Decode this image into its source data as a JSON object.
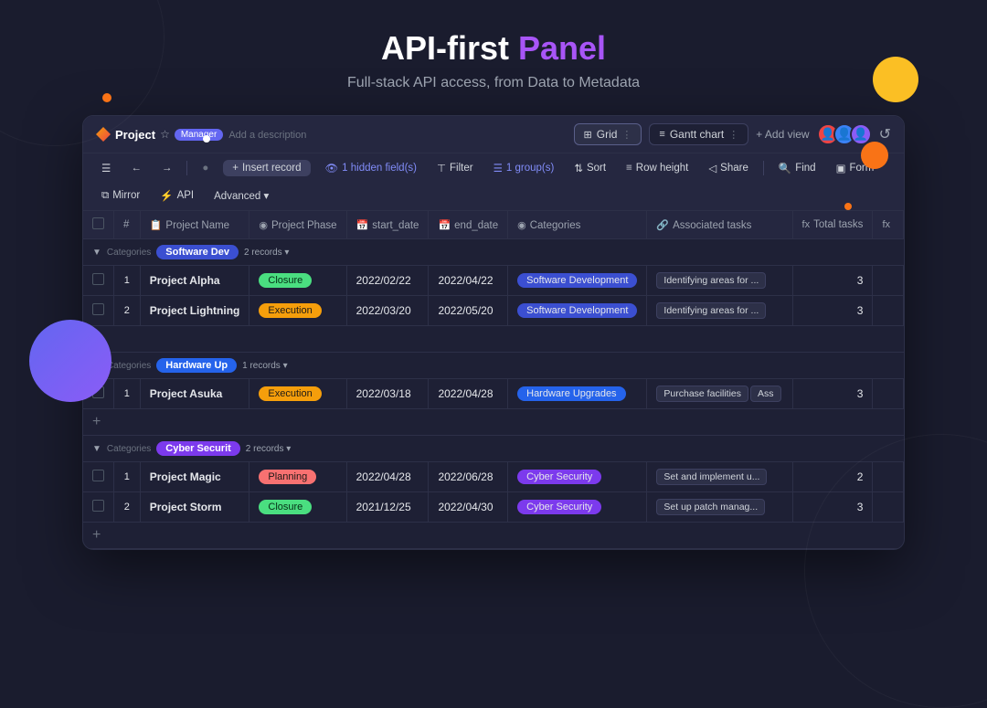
{
  "header": {
    "title_black": "API-first ",
    "title_purple": "Panel",
    "subtitle": "Full-stack API access, from Data to Metadata"
  },
  "panel": {
    "project_name": "Project",
    "manager_label": "Manager",
    "add_description": "Add a description",
    "tabs": [
      {
        "label": "Grid",
        "icon": "⊞",
        "active": true
      },
      {
        "label": "Gantt chart",
        "icon": "≡",
        "active": false
      }
    ],
    "add_view": "+ Add view",
    "avatars": [
      "🧑‍🦰",
      "👩",
      "👨"
    ],
    "refresh_icon": "↺"
  },
  "toolbar": {
    "back": "←",
    "forward": "→",
    "dot": "●",
    "insert": "Insert record",
    "hidden_fields": "1 hidden field(s)",
    "filter": "Filter",
    "group": "1 group(s)",
    "sort": "Sort",
    "row_height": "Row height",
    "share": "Share",
    "find": "Find",
    "form": "Form",
    "mirror": "Mirror",
    "api": "API",
    "advanced": "Advanced ▾"
  },
  "columns": [
    {
      "label": "Project Name",
      "icon": "📋"
    },
    {
      "label": "Project Phase",
      "icon": "◉"
    },
    {
      "label": "start_date",
      "icon": "📅"
    },
    {
      "label": "end_date",
      "icon": "📅"
    },
    {
      "label": "Categories",
      "icon": "◉"
    },
    {
      "label": "Associated tasks",
      "icon": "🔗"
    },
    {
      "label": "Total tasks",
      "icon": "fx"
    }
  ],
  "groups": [
    {
      "name": "Software Dev",
      "label": "Categories",
      "records_count": "2 records",
      "tag_class": "software",
      "rows": [
        {
          "num": 1,
          "project": "Project Alpha",
          "phase": "Closure",
          "phase_class": "phase-closure",
          "start_date": "2022/02/22",
          "end_date": "2022/04/22",
          "category": "Software Development",
          "cat_class": "cat-sw",
          "tasks": [
            "Identifying areas for ..."
          ],
          "total": 3
        },
        {
          "num": 2,
          "project": "Project Lightning",
          "phase": "Execution",
          "phase_class": "phase-execution",
          "start_date": "2022/03/20",
          "end_date": "2022/05/20",
          "category": "Software Development",
          "cat_class": "cat-sw",
          "tasks": [
            "Identifying areas for ..."
          ],
          "total": 3
        }
      ]
    },
    {
      "name": "Hardware Up",
      "label": "Categories",
      "records_count": "1 records",
      "tag_class": "hardware",
      "rows": [
        {
          "num": 1,
          "project": "Project Asuka",
          "phase": "Execution",
          "phase_class": "phase-execution",
          "start_date": "2022/03/18",
          "end_date": "2022/04/28",
          "category": "Hardware Upgrades",
          "cat_class": "cat-hw",
          "tasks": [
            "Purchase facilities",
            "Ass"
          ],
          "total": 3
        }
      ]
    },
    {
      "name": "Cyber Securit",
      "label": "Categories",
      "records_count": "2 records",
      "tag_class": "cyber",
      "rows": [
        {
          "num": 1,
          "project": "Project Magic",
          "phase": "Planning",
          "phase_class": "phase-planning",
          "start_date": "2022/04/28",
          "end_date": "2022/06/28",
          "category": "Cyber Security",
          "cat_class": "cat-cy",
          "tasks": [
            "Set and implement u..."
          ],
          "total": 2
        },
        {
          "num": 2,
          "project": "Project Storm",
          "phase": "Closure",
          "phase_class": "phase-closure",
          "start_date": "2021/12/25",
          "end_date": "2022/04/30",
          "category": "Cyber Security",
          "cat_class": "cat-cy",
          "tasks": [
            "Set up patch manag..."
          ],
          "total": 3
        }
      ]
    }
  ]
}
